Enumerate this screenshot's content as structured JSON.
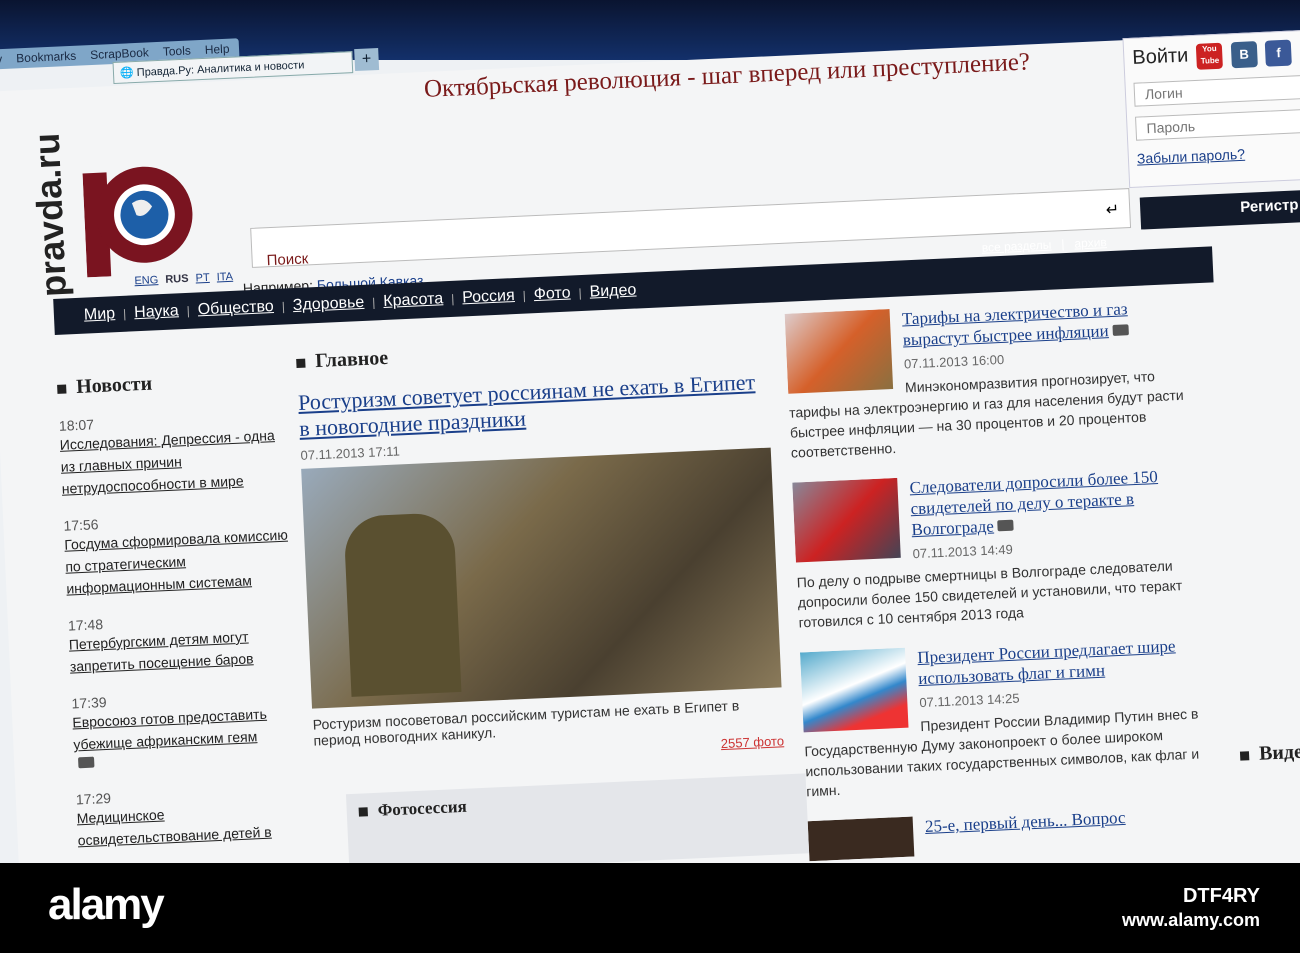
{
  "browser": {
    "menu": [
      "ry",
      "Bookmarks",
      "ScrapBook",
      "Tools",
      "Help"
    ],
    "tab_title": "Правда.Ру: Аналитика и новости",
    "new_tab": "+"
  },
  "header": {
    "headline": "Октябрьская революция - шаг вперед или преступление?",
    "logo": "pravda.ru",
    "languages": [
      "ENG",
      "RUS",
      "PT",
      "ITA"
    ],
    "search_placeholder": "Поиск",
    "example_label": "Например:",
    "example_link": "Большой Кавказ",
    "links": [
      "все разделы",
      "архив"
    ]
  },
  "login": {
    "title": "Войти",
    "login_placeholder": "Логин",
    "password_placeholder": "Пароль",
    "forgot": "Забыли пароль?",
    "register": "Регистр",
    "social": [
      "You Tube",
      "B",
      "f"
    ]
  },
  "nav": [
    "Мир",
    "Наука",
    "Общество",
    "Здоровье",
    "Красота",
    "Россия",
    "Фото",
    "Видео"
  ],
  "news": {
    "title": "Новости",
    "items": [
      {
        "time": "18:07",
        "text": "Исследования: Депрессия - одна из главных причин нетрудоспособности в мире"
      },
      {
        "time": "17:56",
        "text": "Госдума сформировала комиссию по стратегическим информационным системам"
      },
      {
        "time": "17:48",
        "text": "Петербургским детям могут запретить посещение баров"
      },
      {
        "time": "17:39",
        "text": "Евросоюз готов предоставить убежище африканским геям"
      },
      {
        "time": "17:29",
        "text": "Медицинское освидетельствование детей в"
      }
    ]
  },
  "main": {
    "title": "Главное",
    "lead": "Ростуризм советует россиянам не ехать в Египет в новогодние праздники",
    "date": "07.11.2013 17:11",
    "caption": "Ростуризм посоветовал российским туристам не ехать в Египет в период новогодних каникул.",
    "photos": "2557 фото",
    "photosession": "Фотосессия"
  },
  "articles": [
    {
      "title": "Тарифы на электричество и газ вырастут быстрее инфляции",
      "date": "07.11.2013 16:00",
      "body": "Минэкономразвития прогнозирует, что тарифы на электроэнергию и газ для населения будут расти быстрее инфляции — на 30 процентов и 20 процентов соответственно."
    },
    {
      "title": "Следователи допросили более 150 свидетелей по делу о теракте в Волгограде",
      "date": "07.11.2013 14:49",
      "body": "По делу о подрыве смертницы в Волгограде следователи допросили более 150 свидетелей и установили, что теракт готовился с 10 сентября 2013 года"
    },
    {
      "title": "Президент России предлагает шире использовать флаг и гимн",
      "date": "07.11.2013 14:25",
      "body": "Президент России Владимир Путин внес в Государственную Думу законопроект о более широком использовании таких государственных символов, как флаг и гимн."
    },
    {
      "title": "25-е, первый день... Вопрос",
      "date": "",
      "body": ""
    }
  ],
  "video_title": "Видео",
  "watermark": {
    "logo": "alamy",
    "id": "DTF4RY",
    "url": "www.alamy.com"
  }
}
